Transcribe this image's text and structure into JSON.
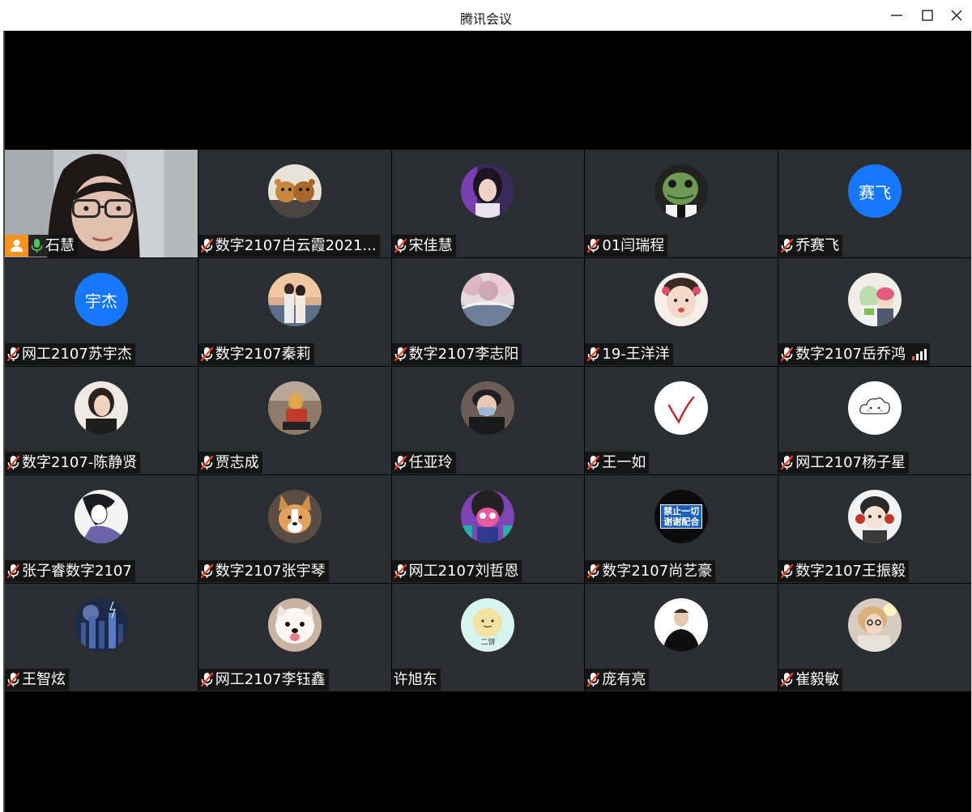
{
  "window": {
    "title": "腾讯会议"
  },
  "tiles": [
    {
      "name": "石慧",
      "avatar": "video",
      "host": true,
      "mic": "on"
    },
    {
      "name": "数字2107白云霞2021...",
      "avatar": "photo-bears",
      "mic": "muted"
    },
    {
      "name": "宋佳慧",
      "avatar": "photo-girl-purple",
      "mic": "muted"
    },
    {
      "name": "01闫瑞程",
      "avatar": "photo-frog-mask",
      "mic": "muted"
    },
    {
      "name": "乔赛飞",
      "avatar": "text",
      "avatar_text": "赛飞",
      "avatar_color": "#1677ff",
      "mic": "muted"
    },
    {
      "name": "网工2107苏宇杰",
      "avatar": "text",
      "avatar_text": "宇杰",
      "avatar_color": "#1677ff",
      "mic": "muted"
    },
    {
      "name": "数字2107秦莉",
      "avatar": "photo-couple",
      "mic": "muted"
    },
    {
      "name": "数字2107李志阳",
      "avatar": "photo-cherry-bridge",
      "mic": "muted"
    },
    {
      "name": "19-王洋洋",
      "avatar": "photo-child",
      "mic": "muted"
    },
    {
      "name": "数字2107岳乔鸿",
      "avatar": "photo-toy",
      "mic": "muted",
      "signal": true
    },
    {
      "name": "数字2107-陈静贤",
      "avatar": "photo-woman",
      "mic": "muted"
    },
    {
      "name": "贾志成",
      "avatar": "photo-figure",
      "mic": "muted"
    },
    {
      "name": "任亚玲",
      "avatar": "photo-mask-man",
      "mic": "muted"
    },
    {
      "name": "王一如",
      "avatar": "photo-check",
      "mic": "muted"
    },
    {
      "name": "网工2107杨子星",
      "avatar": "photo-cloud",
      "mic": "muted"
    },
    {
      "name": "张子睿数字2107",
      "avatar": "photo-anime",
      "mic": "muted"
    },
    {
      "name": "数字2107张宇琴",
      "avatar": "photo-corgi",
      "mic": "muted"
    },
    {
      "name": "网工2107刘哲恩",
      "avatar": "photo-cartoon",
      "mic": "muted"
    },
    {
      "name": "数字2107尚艺豪",
      "avatar": "photo-sign",
      "avatar_text": [
        "禁止一切",
        "谢谢配合"
      ],
      "mic": "muted"
    },
    {
      "name": "数字2107王振毅",
      "avatar": "photo-headphones",
      "mic": "muted"
    },
    {
      "name": "王智炫",
      "avatar": "photo-city",
      "mic": "muted"
    },
    {
      "name": "网工2107李钰鑫",
      "avatar": "photo-dog",
      "mic": "muted"
    },
    {
      "name": "许旭东",
      "avatar": "photo-smiley",
      "avatar_text": "二饼",
      "mic": "none"
    },
    {
      "name": "庞有亮",
      "avatar": "photo-man-black",
      "mic": "muted"
    },
    {
      "name": "崔毅敏",
      "avatar": "photo-blonde",
      "mic": "muted"
    }
  ],
  "colors": {
    "speaking_border": "#2fb35a",
    "host_badge": "#f6921e",
    "tile_bg": "#2a2d31",
    "muted_mic": "#e8412c"
  },
  "icons": {
    "minimize": "minimize-icon",
    "maximize": "maximize-icon",
    "close": "close-icon",
    "muted": "mic-muted-icon",
    "mic_on": "mic-on-icon",
    "host": "host-icon",
    "signal": "signal-icon"
  }
}
